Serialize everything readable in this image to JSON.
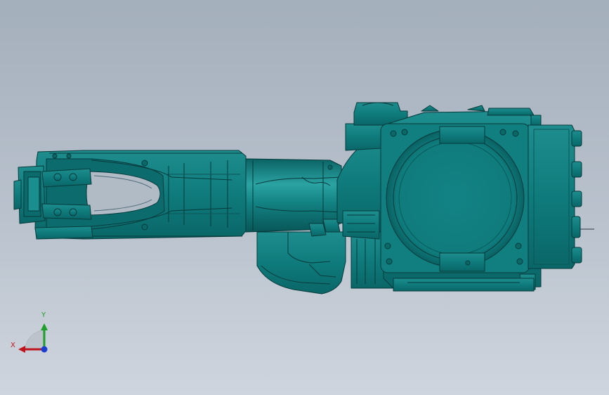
{
  "viewport": {
    "background_top": "#a4afbc",
    "background_bottom": "#cfd5de",
    "model_color": "#0f7b7c",
    "model_edge_color": "#063a3b",
    "model_highlight": "#2a9c9c",
    "model_shadow": "#0a5b5c"
  },
  "model": {
    "parts": [
      "wrist-head",
      "forearm-link",
      "elbow-joint",
      "upper-arm-casting",
      "motor-housing",
      "base-flange",
      "side-connector-panel"
    ],
    "view": "top"
  },
  "triad": {
    "x_label": "X",
    "y_label": "Y",
    "x_color": "#c0141c",
    "y_color": "#1e9e2a",
    "z_color": "#1a3fd0"
  }
}
